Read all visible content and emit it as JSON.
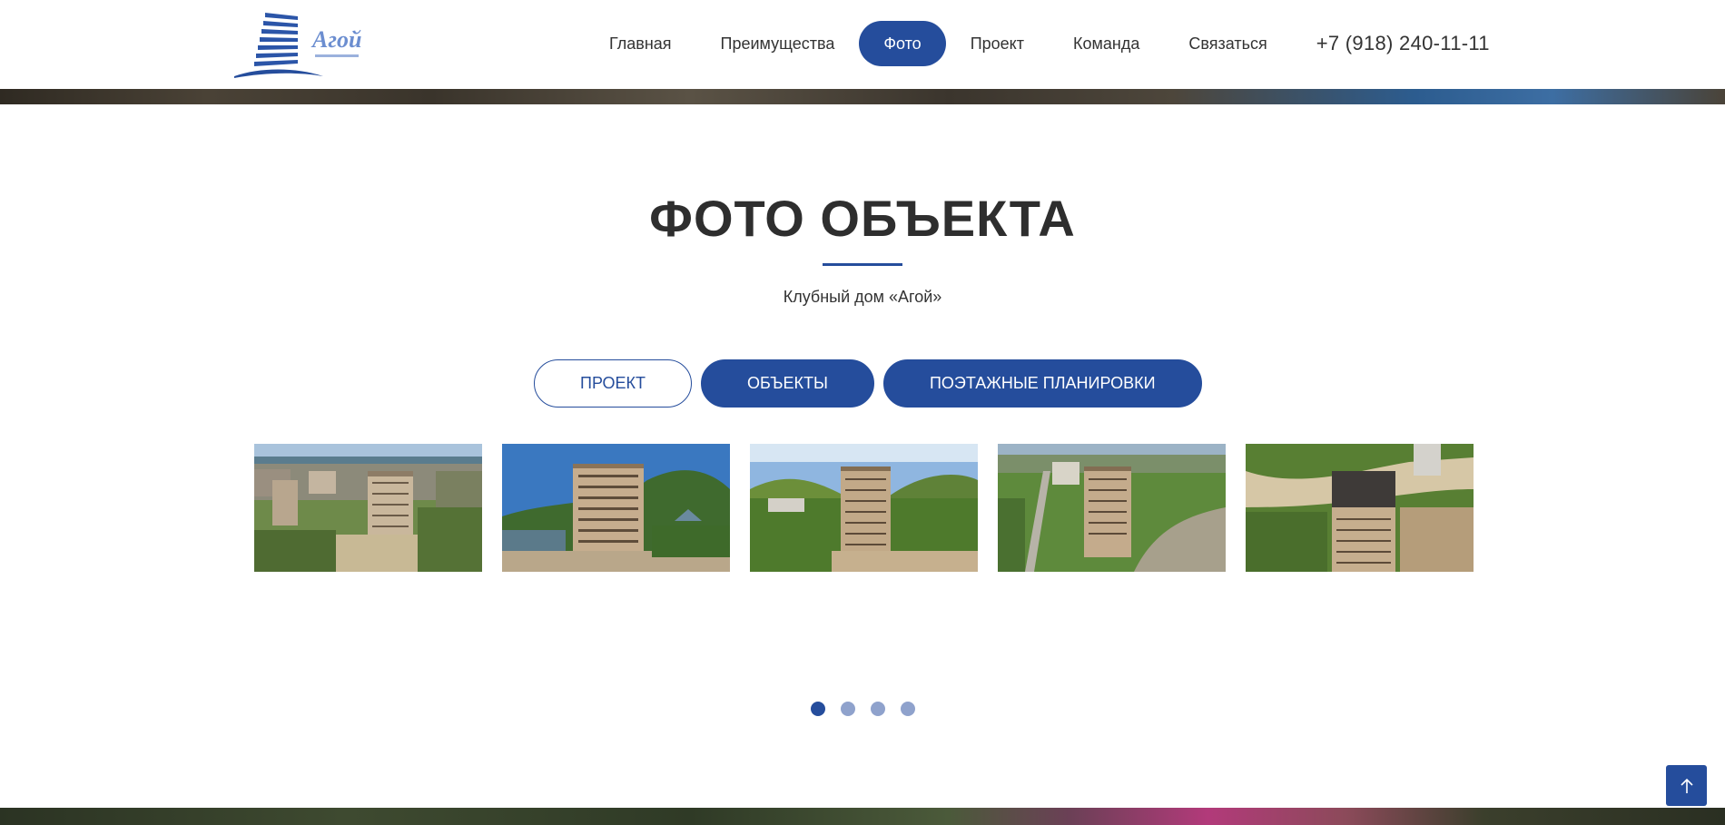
{
  "header": {
    "logo_text": "Агой",
    "nav": [
      {
        "label": "Главная",
        "active": false
      },
      {
        "label": "Преимущества",
        "active": false
      },
      {
        "label": "Фото",
        "active": true
      },
      {
        "label": "Проект",
        "active": false
      },
      {
        "label": "Команда",
        "active": false
      },
      {
        "label": "Связаться",
        "active": false
      }
    ],
    "phone": "+7 (918) 240-11-11"
  },
  "section": {
    "title": "ФОТО ОБЪЕКТА",
    "subtitle": "Клубный дом «Агой»",
    "tabs": [
      {
        "label": "ПРОЕКТ",
        "style": "outline"
      },
      {
        "label": "ОБЪЕКТЫ",
        "style": "filled"
      },
      {
        "label": "ПОЭТАЖНЫЕ ПЛАНИРОВКИ",
        "style": "filled"
      }
    ],
    "photos_count": 5,
    "carousel": {
      "pages": 4,
      "current": 1
    }
  },
  "colors": {
    "accent": "#254d9c",
    "dot_inactive": "#8fa2cc",
    "text": "#333333"
  },
  "icons": {
    "scroll_top": "arrow-up-icon"
  }
}
